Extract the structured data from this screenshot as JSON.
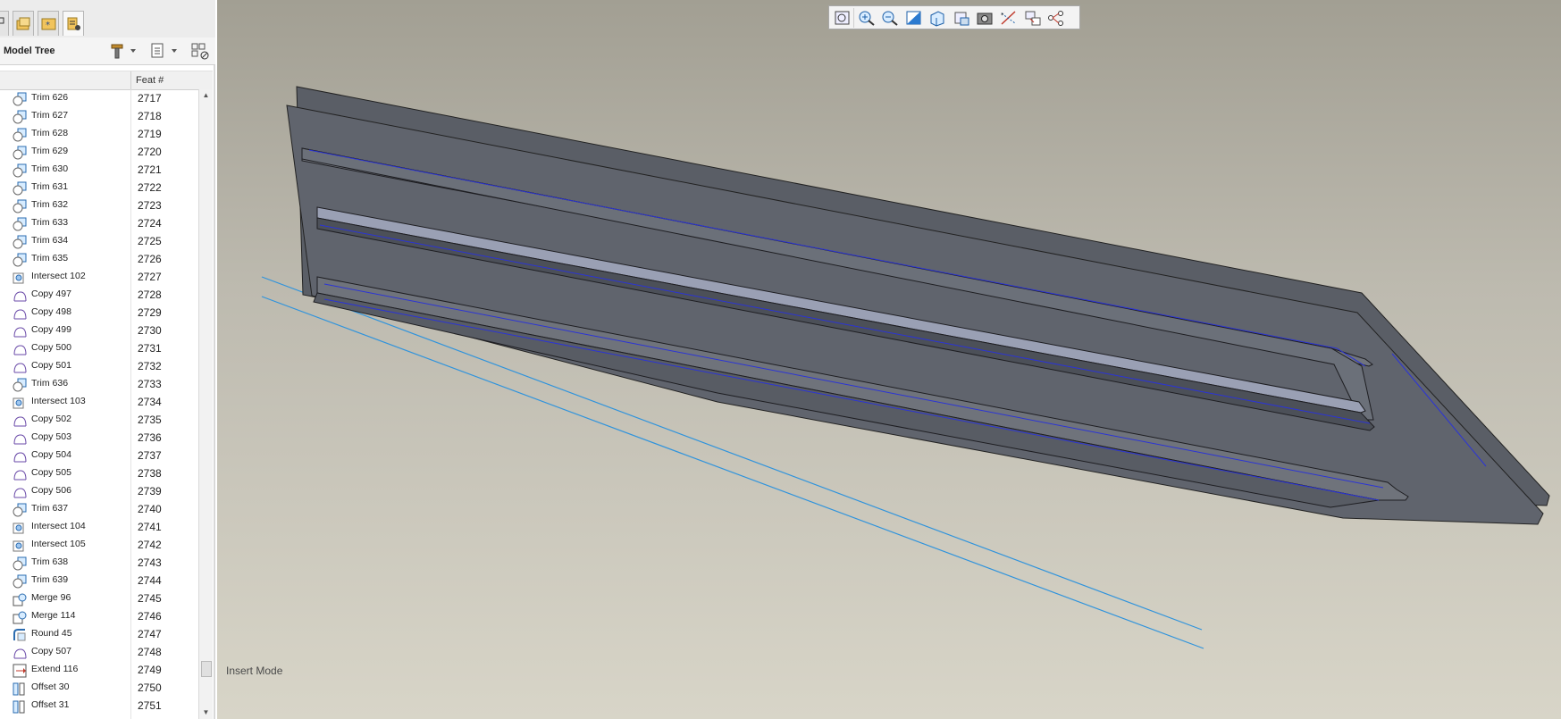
{
  "model_tree": {
    "title": "Model Tree",
    "column_header": "Feat #",
    "rows": [
      {
        "name": "Trim 626",
        "feat": "2717",
        "icon": "trim-icon"
      },
      {
        "name": "Trim 627",
        "feat": "2718",
        "icon": "trim-icon"
      },
      {
        "name": "Trim 628",
        "feat": "2719",
        "icon": "trim-icon"
      },
      {
        "name": "Trim 629",
        "feat": "2720",
        "icon": "trim-icon"
      },
      {
        "name": "Trim 630",
        "feat": "2721",
        "icon": "trim-icon"
      },
      {
        "name": "Trim 631",
        "feat": "2722",
        "icon": "trim-icon"
      },
      {
        "name": "Trim 632",
        "feat": "2723",
        "icon": "trim-icon"
      },
      {
        "name": "Trim 633",
        "feat": "2724",
        "icon": "trim-icon"
      },
      {
        "name": "Trim 634",
        "feat": "2725",
        "icon": "trim-icon"
      },
      {
        "name": "Trim 635",
        "feat": "2726",
        "icon": "trim-icon"
      },
      {
        "name": "Intersect 102",
        "feat": "2727",
        "icon": "intersect-icon"
      },
      {
        "name": "Copy 497",
        "feat": "2728",
        "icon": "copy-icon"
      },
      {
        "name": "Copy 498",
        "feat": "2729",
        "icon": "copy-icon"
      },
      {
        "name": "Copy 499",
        "feat": "2730",
        "icon": "copy-icon"
      },
      {
        "name": "Copy 500",
        "feat": "2731",
        "icon": "copy-icon"
      },
      {
        "name": "Copy 501",
        "feat": "2732",
        "icon": "copy-icon"
      },
      {
        "name": "Trim 636",
        "feat": "2733",
        "icon": "trim-icon"
      },
      {
        "name": "Intersect 103",
        "feat": "2734",
        "icon": "intersect-icon"
      },
      {
        "name": "Copy 502",
        "feat": "2735",
        "icon": "copy-icon"
      },
      {
        "name": "Copy 503",
        "feat": "2736",
        "icon": "copy-icon"
      },
      {
        "name": "Copy 504",
        "feat": "2737",
        "icon": "copy-icon"
      },
      {
        "name": "Copy 505",
        "feat": "2738",
        "icon": "copy-icon"
      },
      {
        "name": "Copy 506",
        "feat": "2739",
        "icon": "copy-icon"
      },
      {
        "name": "Trim 637",
        "feat": "2740",
        "icon": "trim-icon"
      },
      {
        "name": "Intersect 104",
        "feat": "2741",
        "icon": "intersect-icon"
      },
      {
        "name": "Intersect 105",
        "feat": "2742",
        "icon": "intersect-icon"
      },
      {
        "name": "Trim 638",
        "feat": "2743",
        "icon": "trim-icon"
      },
      {
        "name": "Trim 639",
        "feat": "2744",
        "icon": "trim-icon"
      },
      {
        "name": "Merge 96",
        "feat": "2745",
        "icon": "merge-icon"
      },
      {
        "name": "Merge 114",
        "feat": "2746",
        "icon": "merge-icon"
      },
      {
        "name": "Round 45",
        "feat": "2747",
        "icon": "round-icon"
      },
      {
        "name": "Copy 507",
        "feat": "2748",
        "icon": "copy-icon"
      },
      {
        "name": "Extend 116",
        "feat": "2749",
        "icon": "extend-icon"
      },
      {
        "name": "Offset 30",
        "feat": "2750",
        "icon": "offset-icon"
      },
      {
        "name": "Offset 31",
        "feat": "2751",
        "icon": "offset-icon"
      }
    ]
  },
  "tabs": [
    {
      "icon": "model-tree-tab-icon"
    },
    {
      "icon": "folder-browser-tab-icon"
    },
    {
      "icon": "favorites-tab-icon"
    },
    {
      "icon": "layers-tab-icon"
    }
  ],
  "header_tools": [
    {
      "icon": "settings-hammer-icon"
    },
    {
      "icon": "show-filter-icon"
    },
    {
      "icon": "tree-columns-icon"
    }
  ],
  "view_toolbar": [
    {
      "icon": "refit-icon"
    },
    {
      "icon": "zoom-in-icon"
    },
    {
      "icon": "zoom-out-icon"
    },
    {
      "icon": "repaint-icon"
    },
    {
      "icon": "display-style-icon"
    },
    {
      "icon": "saved-orientations-icon"
    },
    {
      "icon": "view-manager-icon"
    },
    {
      "icon": "datum-display-icon"
    },
    {
      "icon": "spin-center-icon"
    },
    {
      "icon": "annotation-display-icon"
    }
  ],
  "status": {
    "mode": "Insert Mode"
  },
  "colors": {
    "surface": "#5c6068",
    "edge_highlight": "#8b90a6",
    "curve_blue": "#1f3fd8",
    "datum_line": "#2f93dc"
  }
}
